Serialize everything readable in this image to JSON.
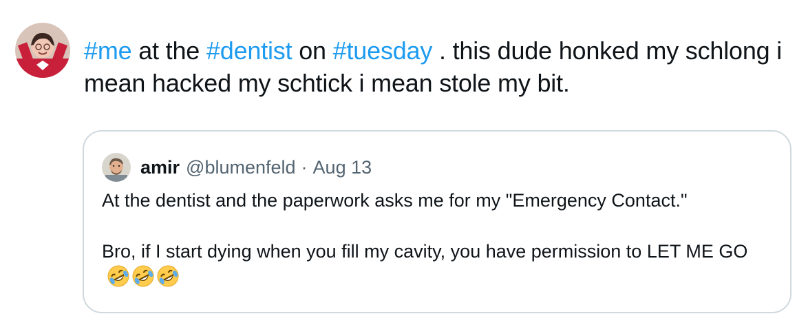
{
  "tweet": {
    "hashtag_1": "#me",
    "text_1": " at the ",
    "hashtag_2": "#dentist",
    "text_2": " on ",
    "hashtag_3": "#tuesday",
    "text_3": " . this dude honked my schlong i mean hacked my schtick i mean stole my bit."
  },
  "quote": {
    "name": "amir",
    "handle": "@blumenfeld",
    "separator": "·",
    "date": "Aug 13",
    "body": "At the dentist and the paperwork asks me for my \"Emergency Contact.\"\n\nBro, if I start dying when you fill my cavity, you have permission to LET ME GO",
    "emoji_name": "rolling-on-floor-laughing-emoji",
    "emoji_count": 3
  },
  "colors": {
    "hashtag": "#1d9bf0",
    "text": "#0f1419",
    "muted": "#536471",
    "border": "#cfd9de"
  }
}
